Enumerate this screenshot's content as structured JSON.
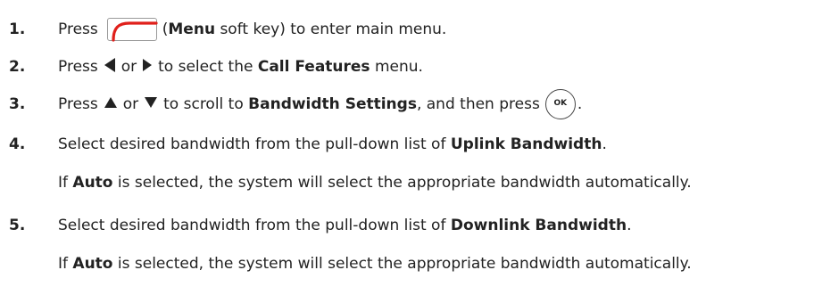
{
  "steps": [
    {
      "number": "1.",
      "press": "Press",
      "open_paren": "(",
      "menu_bold": "Menu",
      "rest": " soft key) to enter main menu."
    },
    {
      "number": "2.",
      "press": "Press",
      "or": "or",
      "to_select": "to select the",
      "menu_bold": "Call Features",
      "rest": " menu."
    },
    {
      "number": "3.",
      "press": "Press",
      "or": "or",
      "scroll": "to scroll to",
      "bold": "Bandwidth Settings",
      "rest": ", and then press",
      "ok_label": "OK",
      "end": "."
    },
    {
      "number": "4.",
      "text": "Select desired bandwidth from the pull-down list of",
      "bold": "Uplink Bandwidth",
      "end": ".",
      "note_if": "If",
      "note_bold": "Auto",
      "note_rest": " is selected, the system will select the appropriate bandwidth automatically."
    },
    {
      "number": "5.",
      "text": "Select desired bandwidth from the pull-down list of",
      "bold": "Downlink Bandwidth",
      "end": ".",
      "note_if": "If",
      "note_bold": "Auto",
      "note_rest": " is selected, the system will select the appropriate bandwidth automatically."
    }
  ],
  "icons": {
    "menu_softkey": "menu-softkey-icon",
    "left": "left-arrow-icon",
    "right": "right-arrow-icon",
    "up": "up-arrow-icon",
    "down": "down-arrow-icon"
  },
  "colors": {
    "softkey_red": "#e0201b",
    "text": "#222222"
  }
}
